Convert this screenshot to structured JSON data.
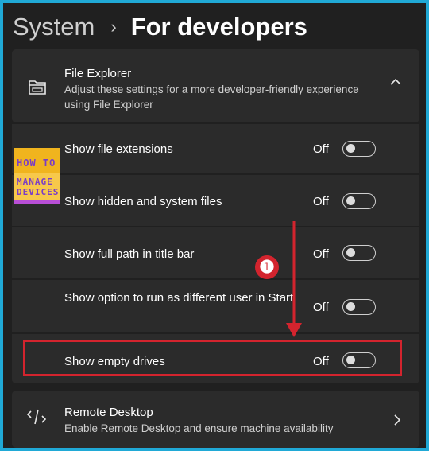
{
  "breadcrumb": {
    "parent": "System",
    "separator": "›",
    "current": "For developers"
  },
  "file_explorer": {
    "title": "File Explorer",
    "description": "Adjust these settings for a more developer-friendly experience using File Explorer",
    "icon": "folder-icon",
    "expanded": true
  },
  "settings": [
    {
      "label": "Show file extensions",
      "state": "Off",
      "on": false
    },
    {
      "label": "Show hidden and system files",
      "state": "Off",
      "on": false
    },
    {
      "label": "Show full path in title bar",
      "state": "Off",
      "on": false
    },
    {
      "label": "Show option to run as different user in Start",
      "state": "Off",
      "on": false
    },
    {
      "label": "Show empty drives",
      "state": "Off",
      "on": false
    }
  ],
  "watermark": {
    "line1": "HOW TO",
    "line2": "MANAGE",
    "line3": "DEVICES"
  },
  "annotation": {
    "step": "❶",
    "color": "#d3242e"
  },
  "remote_desktop": {
    "title": "Remote Desktop",
    "description": "Enable Remote Desktop and ensure machine availability",
    "icon": "remote-desktop-icon"
  },
  "colors": {
    "background": "#202020",
    "card": "#2b2b2b",
    "border": "#20a9d6",
    "accent": "#d3242e"
  }
}
